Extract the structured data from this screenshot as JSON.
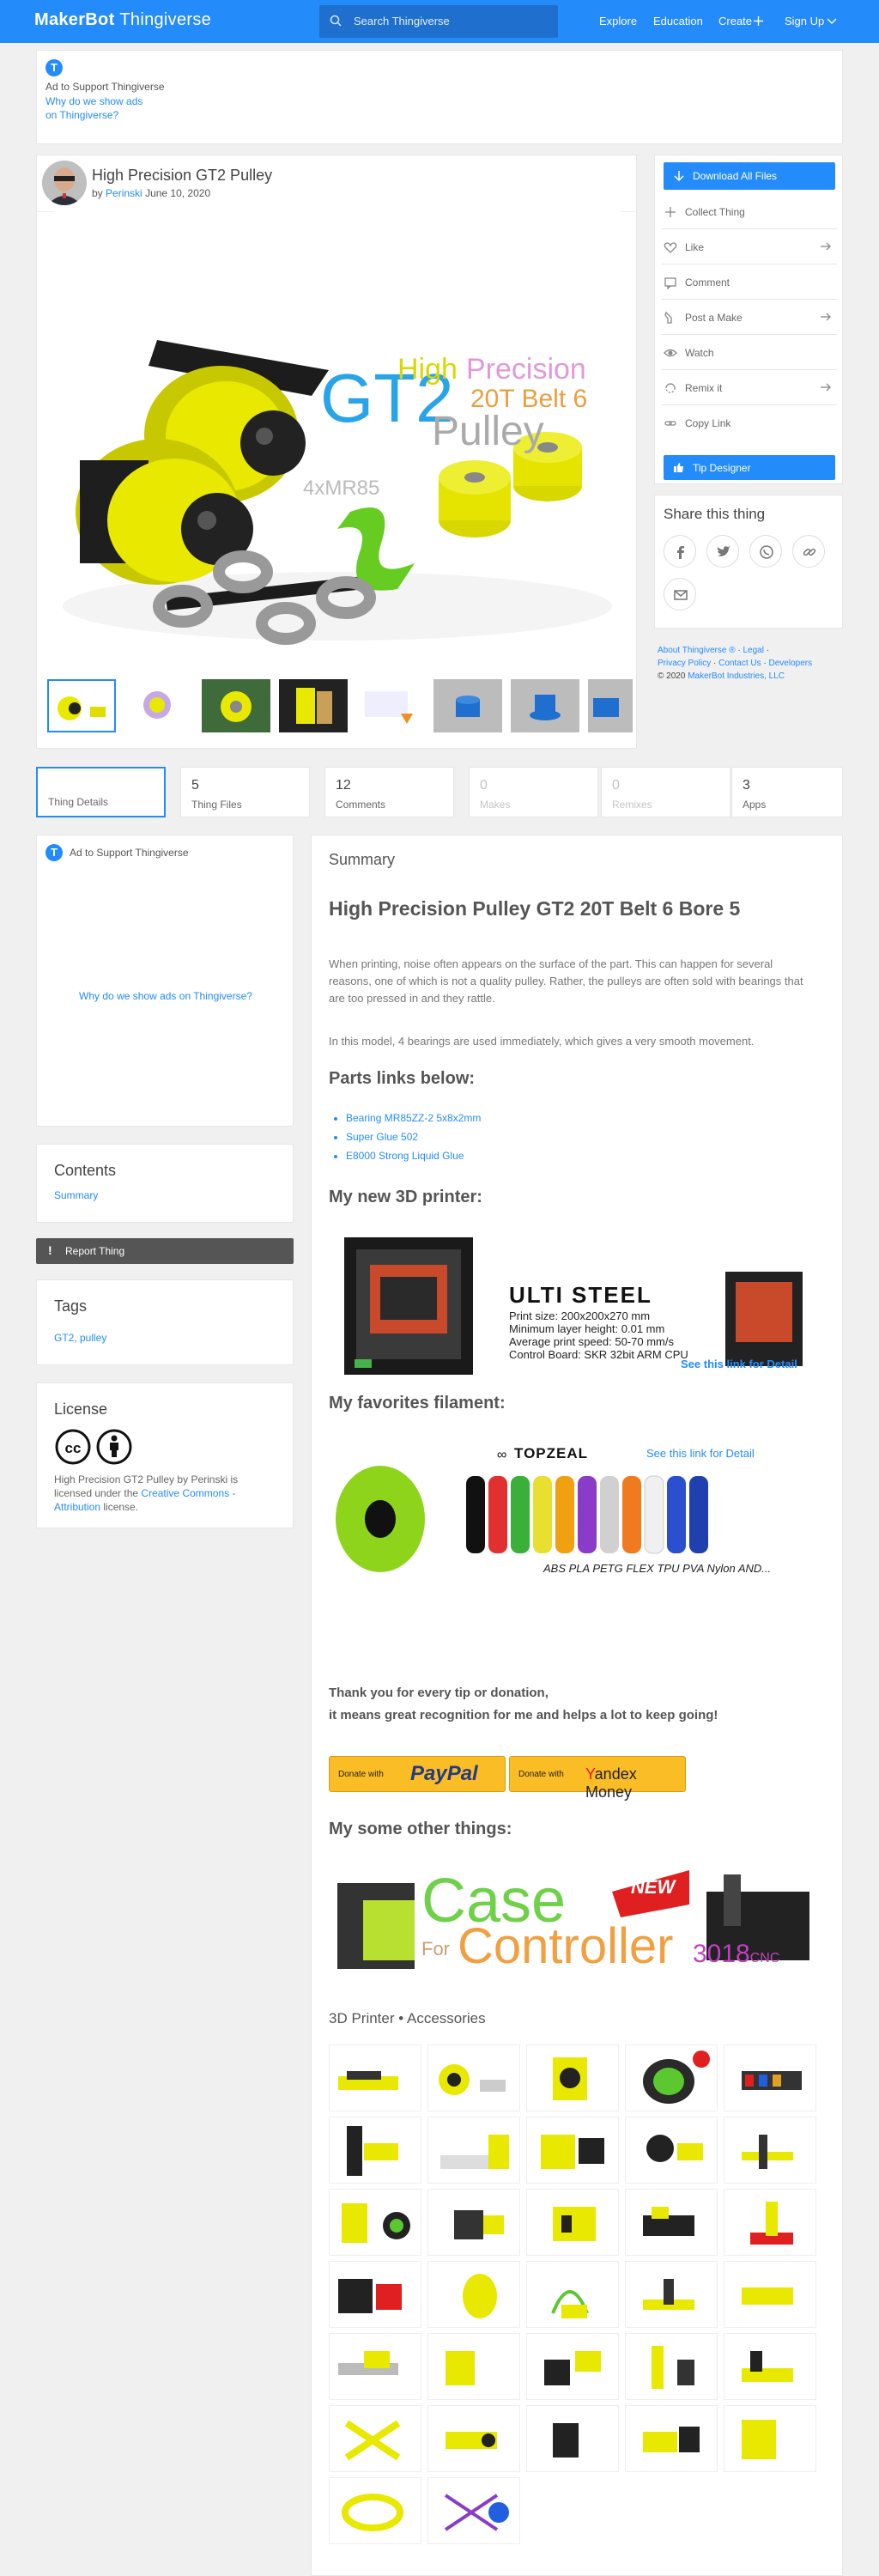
{
  "header": {
    "logo_makerbot": "MakerBot",
    "logo_thingiverse": "Thingiverse",
    "search_placeholder": "Search Thingiverse",
    "nav": [
      "Explore",
      "Education",
      "Create",
      "Sign Up"
    ]
  },
  "ad": {
    "badge": "T",
    "text": "Ad to Support Thingiverse",
    "why1": "Why do we show ads",
    "why2": "on Thingiverse?",
    "why_full": "Why do we show ads on Thingiverse?"
  },
  "thing": {
    "title": "High Precision GT2 Pulley",
    "by": "by",
    "author": "Perinski",
    "date": "June 10, 2020",
    "image_text": {
      "gt2": "GT2",
      "high": "High",
      "precision": "Precision",
      "belt": "20T Belt 6",
      "pulley": "Pulley",
      "bearing": "4xMR85"
    }
  },
  "actions": {
    "download": "Download All Files",
    "items": [
      "Collect Thing",
      "Like",
      "Comment",
      "Post a Make",
      "Watch",
      "Remix it",
      "Copy Link"
    ],
    "tip": "Tip Designer"
  },
  "share": {
    "title": "Share this thing"
  },
  "footer": {
    "line1": [
      "About Thingiverse ®",
      "Legal"
    ],
    "line2": [
      "Privacy Policy",
      "Contact Us",
      "Developers"
    ],
    "copyright": "© 2020",
    "company": "MakerBot Industries, LLC"
  },
  "tabs": [
    {
      "num": "",
      "label": "Thing Details"
    },
    {
      "num": "5",
      "label": "Thing Files"
    },
    {
      "num": "12",
      "label": "Comments"
    },
    {
      "num": "0",
      "label": "Makes"
    },
    {
      "num": "0",
      "label": "Remixes"
    },
    {
      "num": "3",
      "label": "Apps"
    }
  ],
  "contents": {
    "title": "Contents",
    "link": "Summary"
  },
  "report": "Report Thing",
  "tags": {
    "title": "Tags",
    "value": "GT2, pulley"
  },
  "license": {
    "title": "License",
    "t1": "High Precision GT2 Pulley",
    "t2": "by",
    "author": "Perinski",
    "t3": "is licensed under the",
    "link": "Creative Commons - Attribution",
    "t4": "license."
  },
  "summary": {
    "label": "Summary",
    "heading": "High Precision Pulley GT2 20T Belt 6 Bore 5",
    "p1": "When printing, noise often appears on the surface of the part. This can happen for several reasons, one of which is not a quality pulley. Rather, the pulleys are often sold with bearings that are too pressed in and they rattle.",
    "p2": "In this model, 4 bearings are used immediately, which gives a very smooth movement.",
    "parts_heading": "Parts links below:",
    "parts": [
      "Bearing MR85ZZ-2 5x8x2mm",
      "Super Glue 502",
      "E8000 Strong Liquid Glue"
    ],
    "printer_heading": "My new 3D printer:",
    "printer": {
      "name": "ULTI STEEL",
      "specs": [
        "Print size: 200x200x270 mm",
        "Minimum layer height: 0.01 mm",
        "Average print speed: 50-70 mm/s",
        "Control Board: SKR 32bit ARM CPU"
      ],
      "link": "See this link for Detail"
    },
    "filament_heading": "My favorites filament:",
    "filament": {
      "brand": "TOPZEAL",
      "link": "See this link for Detail",
      "types": "ABS PLA PETG FLEX TPU PVA Nylon AND..."
    },
    "thanks1": "Thank you for every tip or donation,",
    "thanks2": "it means great recognition for me and helps a lot to keep going!",
    "donate_with": "Donate with",
    "paypal": "PayPal",
    "yandex_y": "Y",
    "yandex": "andex Money",
    "other_heading": "My some other things:",
    "other_banner": {
      "case": "Case",
      "for": "For",
      "controller": "Controller",
      "new": "NEW",
      "cnc": "3018",
      "cnc_suffix": "CNC"
    },
    "accessories": "3D Printer • Accessories"
  },
  "colors": {
    "accent": "#248bfb",
    "yellow": "#e8e800"
  }
}
